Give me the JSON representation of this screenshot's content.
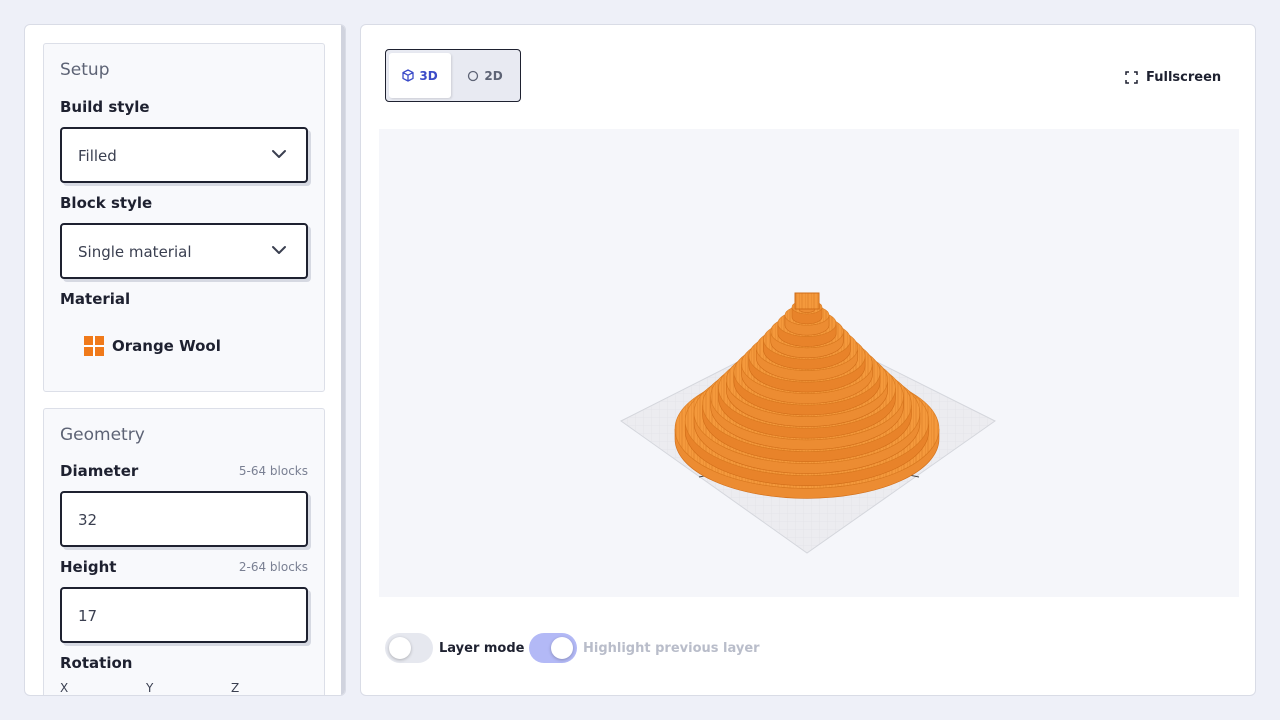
{
  "setup": {
    "title": "Setup",
    "build_style_label": "Build style",
    "build_style_value": "Filled",
    "block_style_label": "Block style",
    "block_style_value": "Single material",
    "material_label": "Material",
    "material_value": "Orange Wool",
    "material_color": "#f07a1a"
  },
  "geometry": {
    "title": "Geometry",
    "diameter_label": "Diameter",
    "diameter_hint": "5-64 blocks",
    "diameter_value": "32",
    "height_label": "Height",
    "height_hint": "2-64 blocks",
    "height_value": "17",
    "rotation_label": "Rotation",
    "axes": [
      "X",
      "Y",
      "Z"
    ]
  },
  "viewer": {
    "view_3d_label": "3D",
    "view_2d_label": "2D",
    "active_view": "3D",
    "fullscreen_label": "Fullscreen",
    "layer_mode_label": "Layer mode",
    "layer_mode_on": false,
    "highlight_label": "Highlight previous layer",
    "highlight_on": true,
    "accent_color": "#3b4bc8"
  }
}
